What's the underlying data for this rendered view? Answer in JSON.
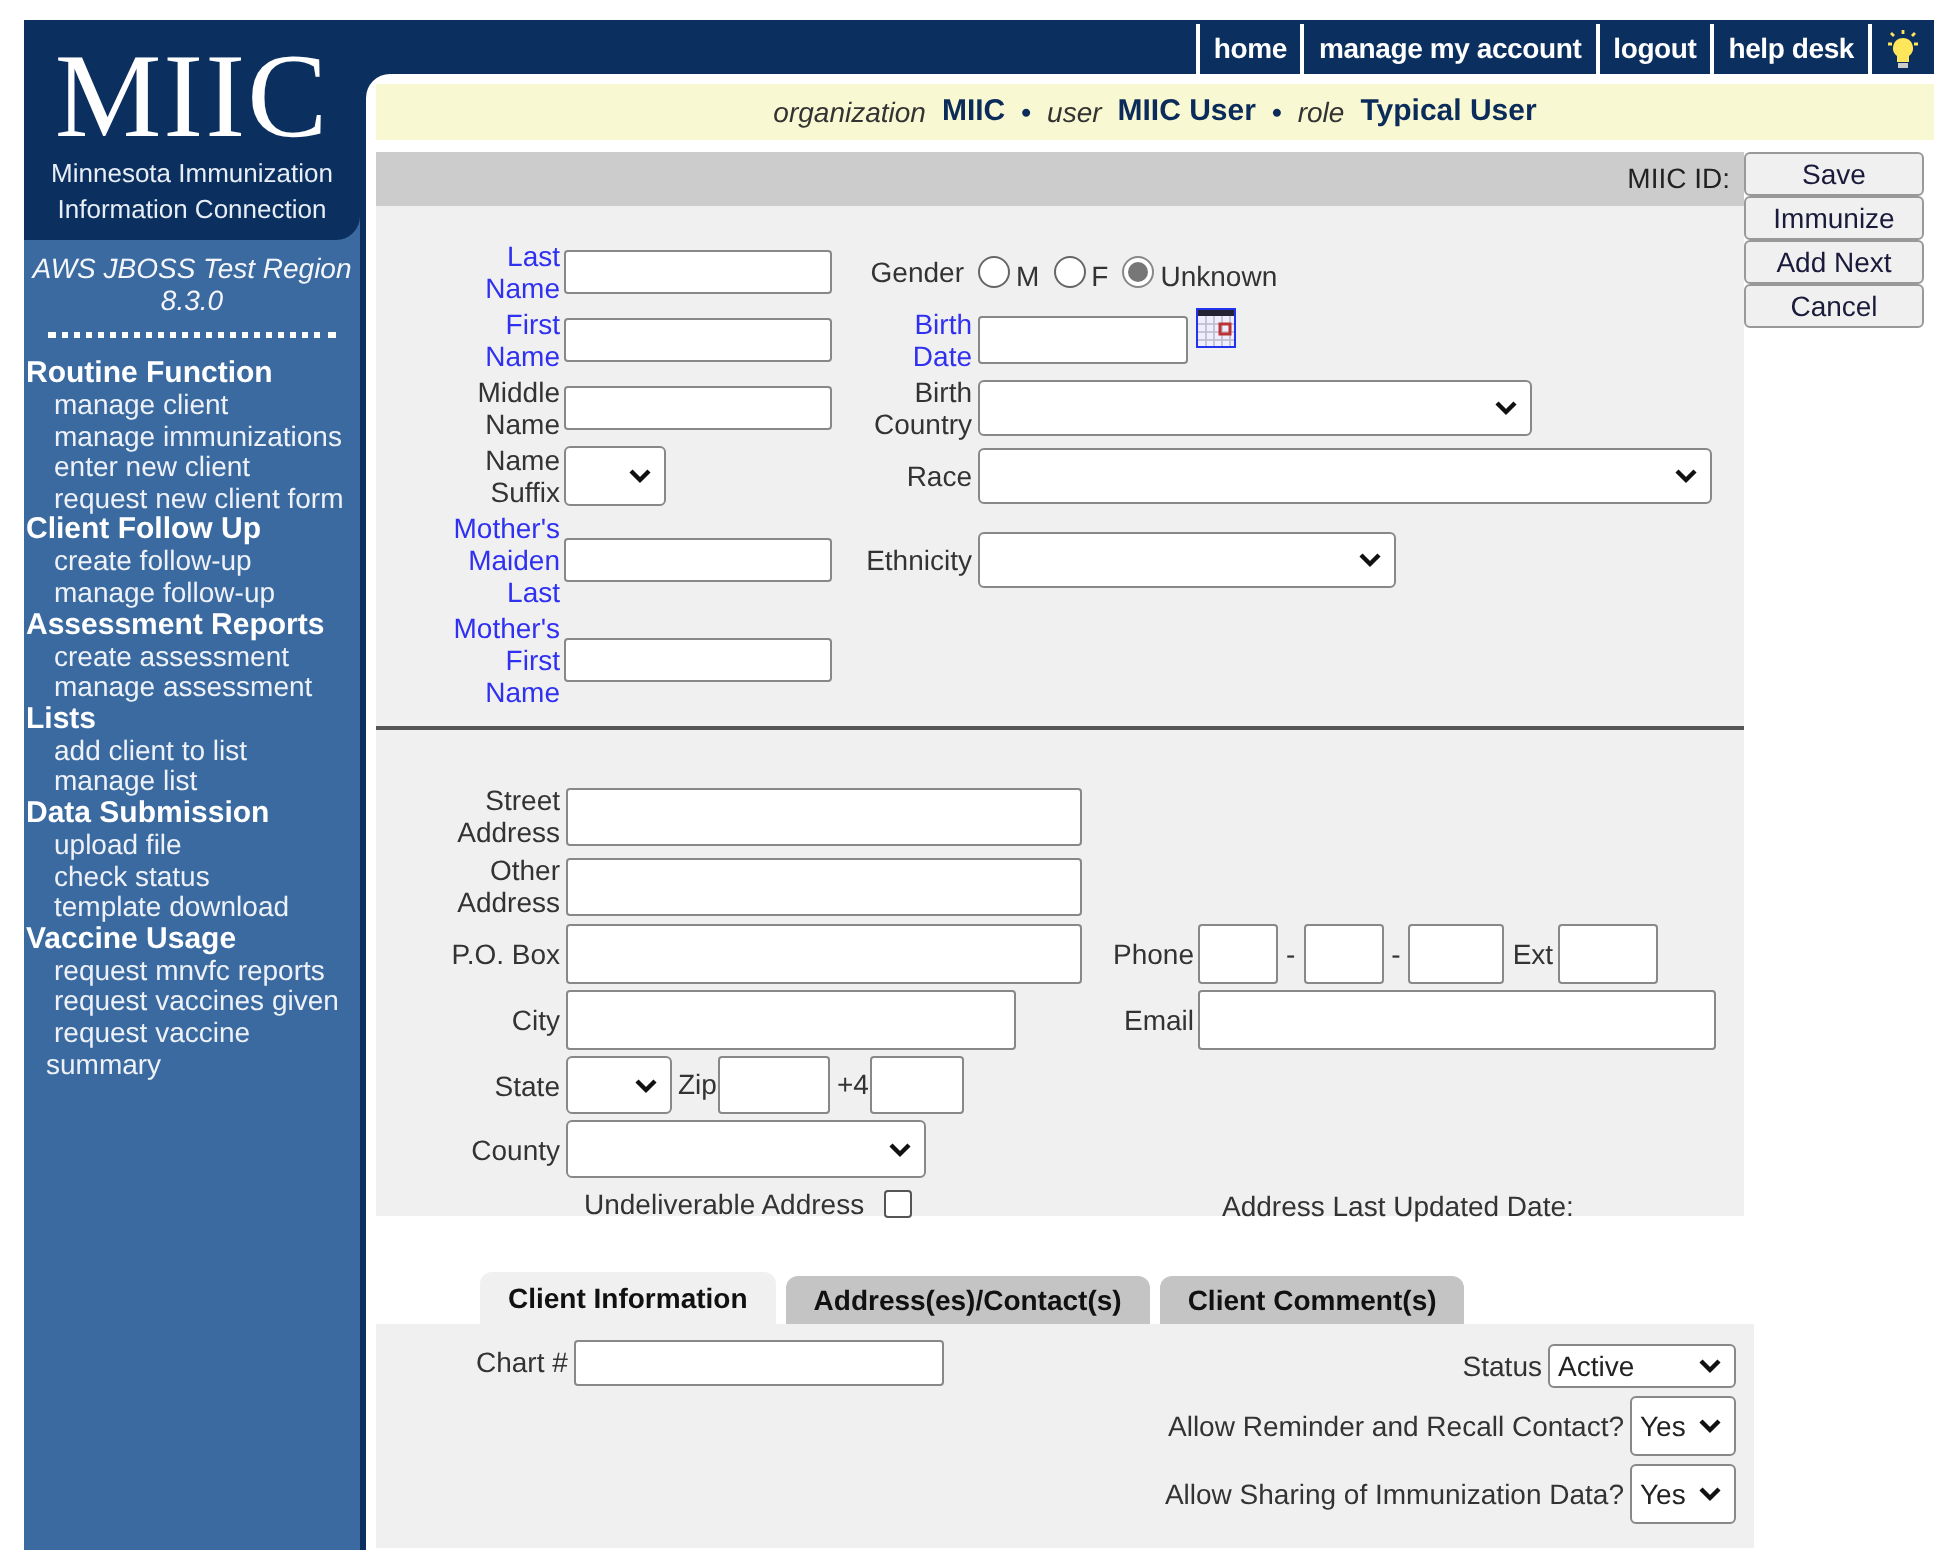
{
  "logo": {
    "title": "MIIC",
    "subtitle": "Minnesota Immunization Information Connection"
  },
  "region": "AWS JBOSS Test Region 8.3.0",
  "sidebar": {
    "sections": [
      {
        "heading": "Routine Function",
        "items": [
          "manage client",
          "manage immunizations",
          "enter new client",
          "request new client form"
        ]
      },
      {
        "heading": "Client Follow Up",
        "items": [
          "create follow-up",
          "manage follow-up"
        ]
      },
      {
        "heading": "Assessment Reports",
        "items": [
          "create assessment",
          "manage assessment"
        ]
      },
      {
        "heading": "Lists",
        "items": [
          "add client to list",
          "manage list"
        ]
      },
      {
        "heading": "Data Submission",
        "items": [
          "upload file",
          "check status",
          "template download"
        ]
      },
      {
        "heading": "Vaccine Usage",
        "items": [
          "request mnvfc reports",
          "request vaccines given",
          "request vaccine summary"
        ]
      }
    ]
  },
  "nav": {
    "links": [
      "home",
      "manage my account",
      "logout",
      "help desk"
    ]
  },
  "context": {
    "separator": "•",
    "items": [
      {
        "label": "organization",
        "value": "MIIC"
      },
      {
        "label": "user",
        "value": "MIIC User"
      },
      {
        "label": "role",
        "value": "Typical User"
      }
    ]
  },
  "id_label": "MIIC ID:",
  "buttons": [
    "Save",
    "Immunize",
    "Add Next",
    "Cancel"
  ],
  "demographics": {
    "rows": [
      {
        "left": [
          {
            "label": "Last Name",
            "kind": "text",
            "required": true
          }
        ],
        "right": [
          {
            "label": "Gender",
            "kind": "radio",
            "required": false,
            "options": [
              {
                "label": "M",
                "selected": false
              },
              {
                "label": "F",
                "selected": false
              },
              {
                "label": "Unknown",
                "selected": true
              }
            ]
          }
        ]
      },
      {
        "left": [
          {
            "label": "First Name",
            "kind": "text",
            "required": true
          }
        ],
        "right": [
          {
            "label": "Birth Date",
            "kind": "date",
            "required": true
          }
        ]
      },
      {
        "left": [
          {
            "label": "Middle Name",
            "kind": "text",
            "required": false
          }
        ],
        "right": [
          {
            "label": "Birth Country",
            "kind": "select",
            "required": false
          }
        ]
      },
      {
        "left": [
          {
            "label": "Name Suffix",
            "kind": "select",
            "required": false
          }
        ],
        "right": [
          {
            "label": "Race",
            "kind": "select",
            "required": false
          }
        ]
      },
      {
        "left": [
          {
            "label": "Mother's Maiden Last",
            "kind": "text",
            "required": true
          }
        ],
        "right": [
          {
            "label": "Ethnicity",
            "kind": "select",
            "required": false
          }
        ]
      },
      {
        "left": [
          {
            "label": "Mother's First Name",
            "kind": "text",
            "required": true
          }
        ],
        "right": []
      }
    ]
  },
  "address": {
    "rows": [
      {
        "left": [
          {
            "label": "Street Address",
            "kind": "text"
          }
        ],
        "right": []
      },
      {
        "left": [
          {
            "label": "Other Address",
            "kind": "text"
          }
        ],
        "right": []
      },
      {
        "left": [
          {
            "label": "P.O. Box",
            "kind": "text"
          }
        ],
        "right": [
          {
            "label": "Phone",
            "kind": "phone",
            "separator": "-",
            "ext_label": "Ext"
          }
        ]
      },
      {
        "left": [
          {
            "label": "City",
            "kind": "text"
          }
        ],
        "right": [
          {
            "label": "Email",
            "kind": "text"
          }
        ]
      },
      {
        "left": [
          {
            "label": "State",
            "kind": "select"
          },
          {
            "label": "Zip",
            "kind": "text"
          },
          {
            "label": "+4",
            "kind": "text"
          }
        ],
        "right": []
      },
      {
        "left": [
          {
            "label": "County",
            "kind": "select"
          }
        ],
        "right": []
      },
      {
        "left": [
          {
            "label": "Undeliverable Address",
            "kind": "checkbox",
            "checked": false
          }
        ],
        "right": [
          {
            "label": "Address Last Updated Date:",
            "kind": "note"
          }
        ]
      }
    ]
  },
  "tabs": [
    {
      "label": "Client Information",
      "selected": true
    },
    {
      "label": "Address(es)/Contact(s)",
      "selected": false
    },
    {
      "label": "Client Comment(s)",
      "selected": false
    }
  ],
  "client_info": {
    "chart": {
      "label": "Chart #"
    },
    "settings": [
      {
        "label": "Status",
        "value": "Active"
      },
      {
        "label": "Allow Reminder and Recall Contact?",
        "value": "Yes"
      },
      {
        "label": "Allow Sharing of Immunization Data?",
        "value": "Yes"
      }
    ]
  }
}
